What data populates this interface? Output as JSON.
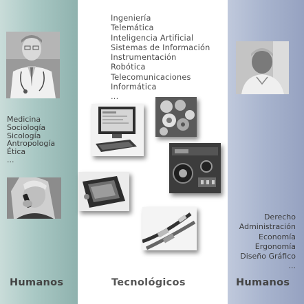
{
  "columns": {
    "left": {
      "items": [
        "Medicina",
        "Sociología",
        "Sicología",
        "Antropología",
        "Ética",
        "..."
      ],
      "footer": "Humanos"
    },
    "middle": {
      "items": [
        "Ingeniería",
        "Telemática",
        "Inteligencia Artificial",
        "Sistemas de Información",
        "Instrumentación",
        "Robótica",
        "Telecomunicaciones",
        "Informática",
        "..."
      ],
      "footer": "Tecnológicos"
    },
    "right": {
      "items": [
        "Derecho",
        "Administración",
        "Economía",
        "Ergonomía",
        "Diseño Gráfico",
        "..."
      ],
      "footer": "Humanos"
    }
  },
  "colors": {
    "left_column": "#a9c8c4",
    "right_column": "#a7b3cd",
    "text": "#3a3a3a"
  }
}
